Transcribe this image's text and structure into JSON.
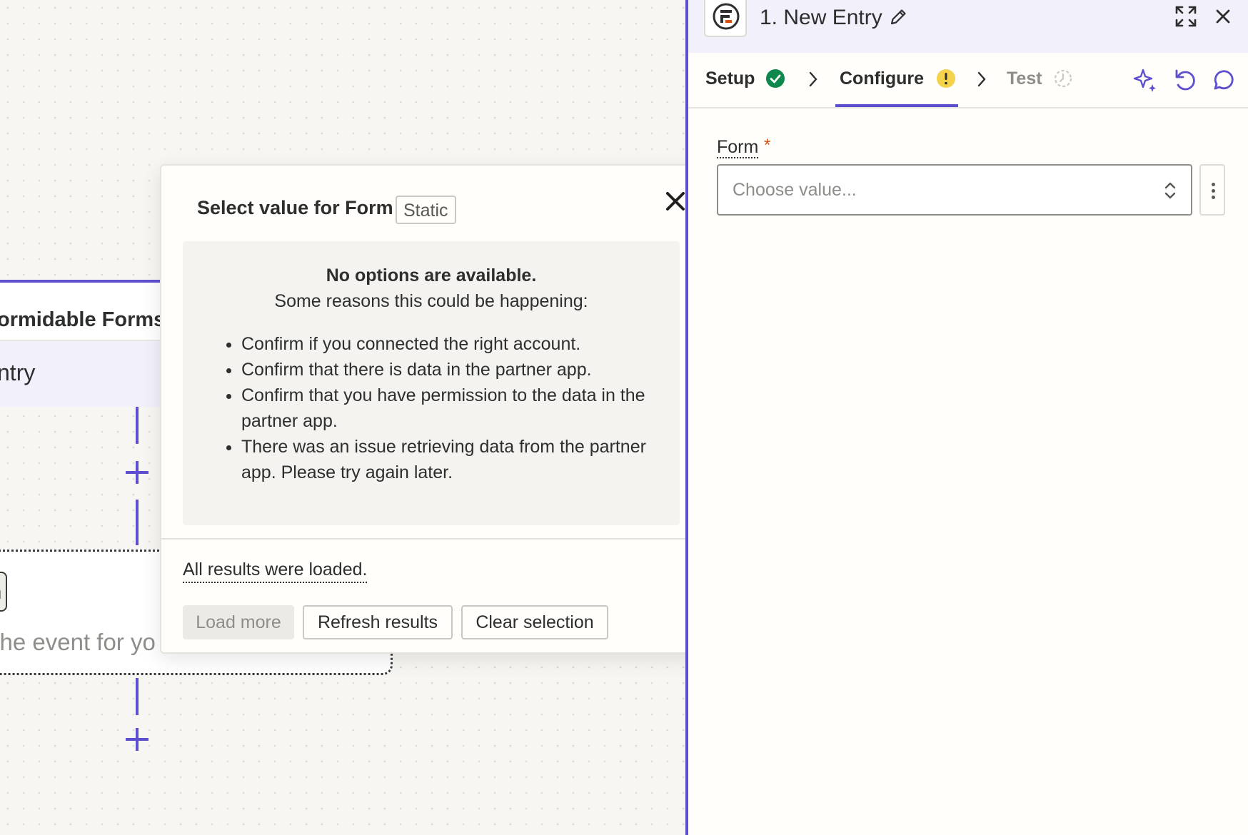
{
  "canvas": {
    "trigger_app": "ormidable Forms",
    "trigger_event": "ntry",
    "action_chip": "n",
    "action_text": "t the event for yo"
  },
  "modal": {
    "title": "Select value for Form",
    "tag": "Static",
    "close_icon": "close-icon",
    "info_heading": "No options are available.",
    "info_sub": "Some reasons this could be happening:",
    "reasons": [
      "Confirm if you connected the right account.",
      "Confirm that there is data in the partner app.",
      "Confirm that you have permission to the data in the partner app.",
      "There was an issue retrieving data from the partner app. Please try again later."
    ],
    "loaded_text": "All results were loaded.",
    "buttons": {
      "load_more": "Load more",
      "refresh": "Refresh results",
      "clear": "Clear selection"
    }
  },
  "panel": {
    "title": "1. New Entry",
    "steps": {
      "setup": "Setup",
      "configure": "Configure",
      "test": "Test"
    },
    "form_field": {
      "label": "Form",
      "required_mark": "*",
      "placeholder": "Choose value..."
    }
  },
  "colors": {
    "accent": "#5e4fcf",
    "success": "#0f884e",
    "warning": "#f5d24b",
    "required": "#d3510e"
  }
}
